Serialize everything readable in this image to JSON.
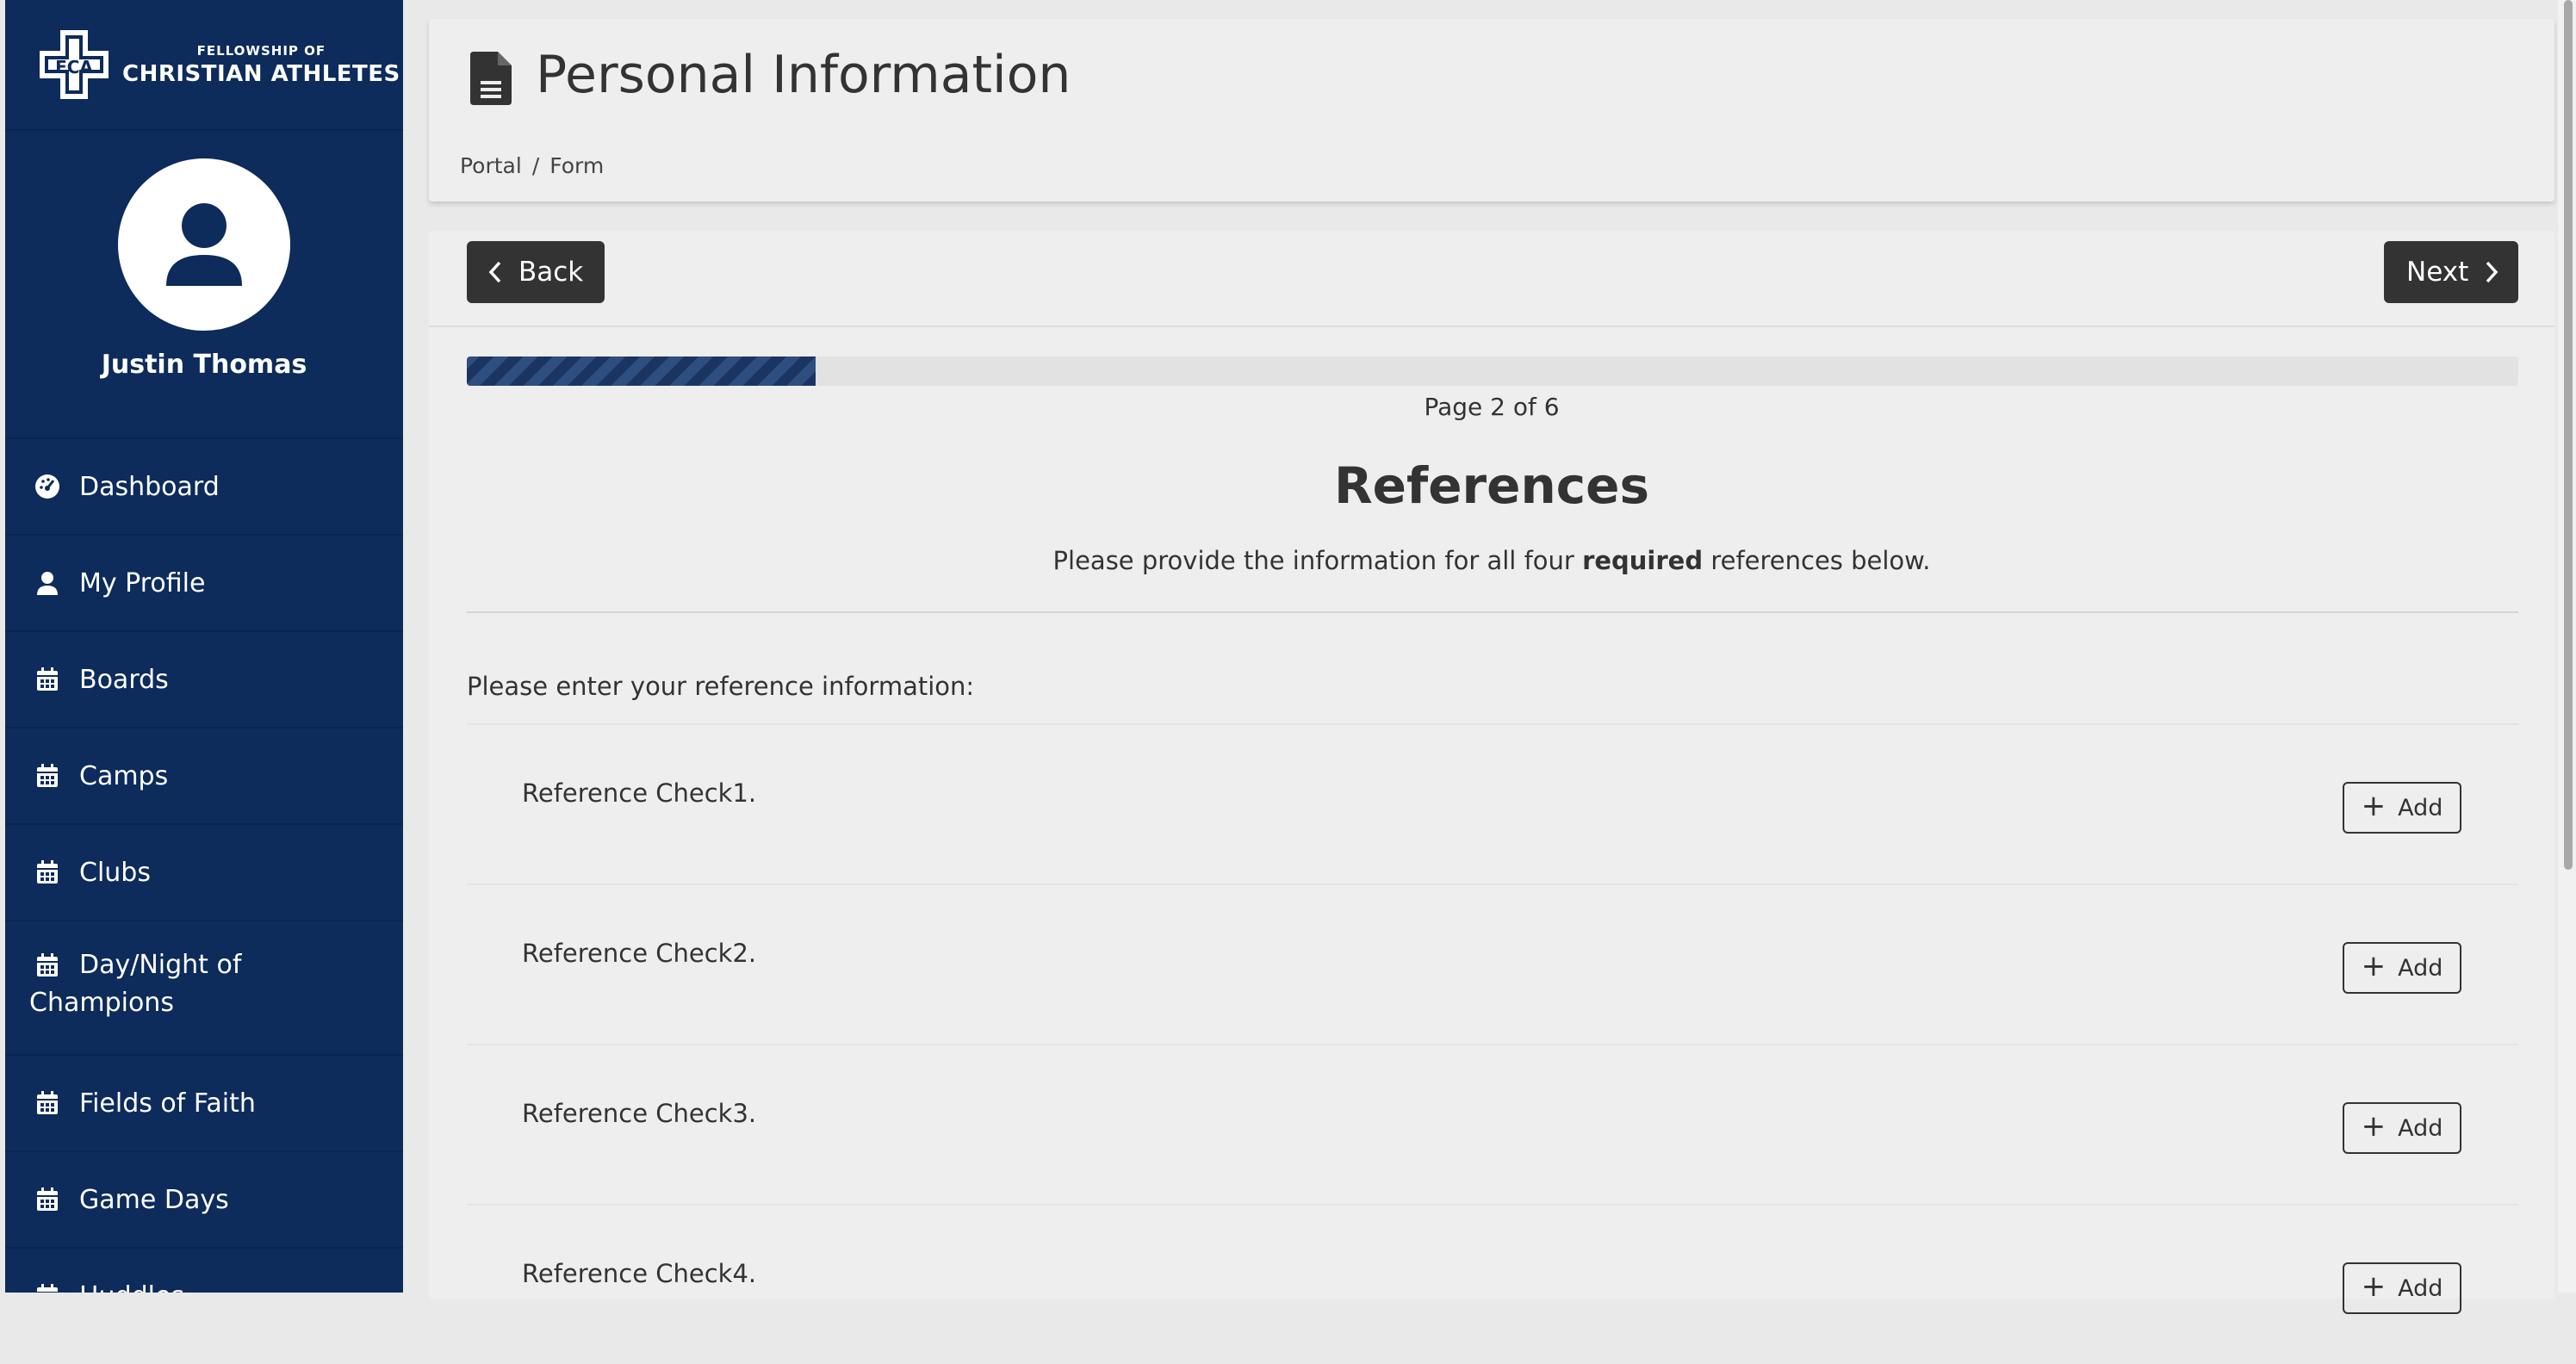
{
  "brand": {
    "line1": "FELLOWSHIP OF",
    "line2": "CHRISTIAN ATHLETES",
    "logo_text": "FCA"
  },
  "user": {
    "name": "Justin Thomas"
  },
  "nav": {
    "items": [
      {
        "label": "Dashboard",
        "icon": "dashboard-gauge-icon"
      },
      {
        "label": "My Profile",
        "icon": "user-icon"
      },
      {
        "label": "Boards",
        "icon": "calendar-icon"
      },
      {
        "label": "Camps",
        "icon": "calendar-icon"
      },
      {
        "label": "Clubs",
        "icon": "calendar-icon"
      },
      {
        "label_line1": "Day/Night of",
        "label_line2": "Champions",
        "icon": "calendar-icon"
      },
      {
        "label": "Fields of Faith",
        "icon": "calendar-icon"
      },
      {
        "label": "Game Days",
        "icon": "calendar-icon"
      },
      {
        "label": "Huddles",
        "icon": "calendar-icon"
      }
    ]
  },
  "header": {
    "title": "Personal Information",
    "breadcrumb": [
      "Portal",
      "Form"
    ],
    "breadcrumb_separator": "/"
  },
  "form": {
    "back_label": "Back",
    "next_label": "Next",
    "progress_fraction": 0.17,
    "page_indicator": "Page 2 of 6",
    "section_title": "References",
    "instructions_before": "Please provide the information for all four ",
    "instructions_bold": "required",
    "instructions_after": " references below.",
    "prompt": "Please enter your reference information:",
    "add_label": "Add",
    "references": [
      {
        "label": "Reference Check1."
      },
      {
        "label": "Reference Check2."
      },
      {
        "label": "Reference Check3."
      },
      {
        "label": "Reference Check4."
      }
    ]
  },
  "colors": {
    "sidebar_bg": "#0d2b5b",
    "button_dark": "#333333",
    "progress_fill": "#1a3562"
  }
}
